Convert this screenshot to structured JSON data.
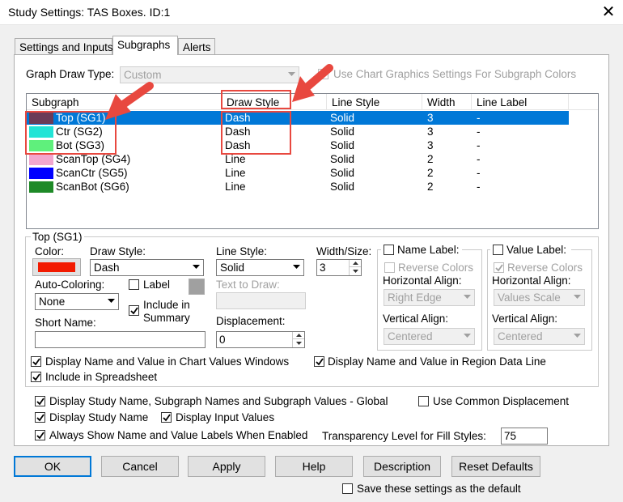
{
  "window": {
    "title": "Study Settings: TAS Boxes. ID:1",
    "close_glyph": "✕"
  },
  "tabs": [
    {
      "label": "Settings and Inputs"
    },
    {
      "label": "Subgraphs"
    },
    {
      "label": "Alerts"
    }
  ],
  "graph_draw_type": {
    "label": "Graph Draw Type:",
    "value": "Custom"
  },
  "chart_graphics": {
    "label": "Use Chart Graphics Settings For Subgraph Colors",
    "checked": false
  },
  "list": {
    "columns": [
      "Subgraph",
      "Draw Style",
      "Line Style",
      "Width",
      "Line Label"
    ],
    "rows": [
      {
        "name": "Top (SG1)",
        "color": "#6b3b57",
        "draw": "Dash",
        "line": "Solid",
        "width": "3",
        "label": "-"
      },
      {
        "name": "Ctr (SG2)",
        "color": "#22e4d6",
        "draw": "Dash",
        "line": "Solid",
        "width": "3",
        "label": "-"
      },
      {
        "name": "Bot (SG3)",
        "color": "#5ff07c",
        "draw": "Dash",
        "line": "Solid",
        "width": "3",
        "label": "-"
      },
      {
        "name": "ScanTop (SG4)",
        "color": "#f2a6cf",
        "draw": "Line",
        "line": "Solid",
        "width": "2",
        "label": "-"
      },
      {
        "name": "ScanCtr (SG5)",
        "color": "#0000ff",
        "draw": "Line",
        "line": "Solid",
        "width": "2",
        "label": "-"
      },
      {
        "name": "ScanBot (SG6)",
        "color": "#1e8a27",
        "draw": "Line",
        "line": "Solid",
        "width": "2",
        "label": "-"
      }
    ]
  },
  "group": {
    "title": "Top (SG1)"
  },
  "color": {
    "label": "Color:",
    "value": "#f21a00"
  },
  "draw_style": {
    "label": "Draw Style:",
    "value": "Dash"
  },
  "line_style": {
    "label": "Line Style:",
    "value": "Solid"
  },
  "width_size": {
    "label": "Width/Size:",
    "value": "3"
  },
  "auto_coloring": {
    "label": "Auto-Coloring:",
    "value": "None"
  },
  "label_chk": {
    "label": "Label"
  },
  "include_summary": {
    "label": "Include in Summary",
    "checked": true
  },
  "text_to_draw": {
    "label": "Text to Draw:"
  },
  "short_name": {
    "label": "Short Name:",
    "value": ""
  },
  "displacement": {
    "label": "Displacement:",
    "value": "0"
  },
  "name_label": {
    "title": "Name Label:",
    "reverse": "Reverse Colors",
    "h_label": "Horizontal Align:",
    "h_value": "Right Edge",
    "v_label": "Vertical Align:",
    "v_value": "Centered"
  },
  "value_label": {
    "title": "Value Label:",
    "reverse": "Reverse Colors",
    "h_label": "Horizontal Align:",
    "h_value": "Values Scale",
    "v_label": "Vertical Align:",
    "v_value": "Centered"
  },
  "opts": {
    "chart_values": "Display Name and Value in Chart Values Windows",
    "region_data": "Display Name and Value in Region Data Line",
    "spreadsheet": "Include in Spreadsheet",
    "global": "Display Study Name, Subgraph Names and Subgraph Values - Global",
    "common_disp": "Use Common Displacement",
    "study_name": "Display Study Name",
    "input_values": "Display Input Values",
    "always_show": "Always Show Name and Value Labels When Enabled",
    "transparency_label": "Transparency Level for Fill Styles:",
    "transparency_value": "75"
  },
  "buttons": {
    "ok": "OK",
    "cancel": "Cancel",
    "apply": "Apply",
    "help": "Help",
    "description": "Description",
    "reset": "Reset Defaults"
  },
  "save_default": "Save these settings as the default",
  "annotation_color": "#e8483f",
  "selection_color": "#0078d7"
}
